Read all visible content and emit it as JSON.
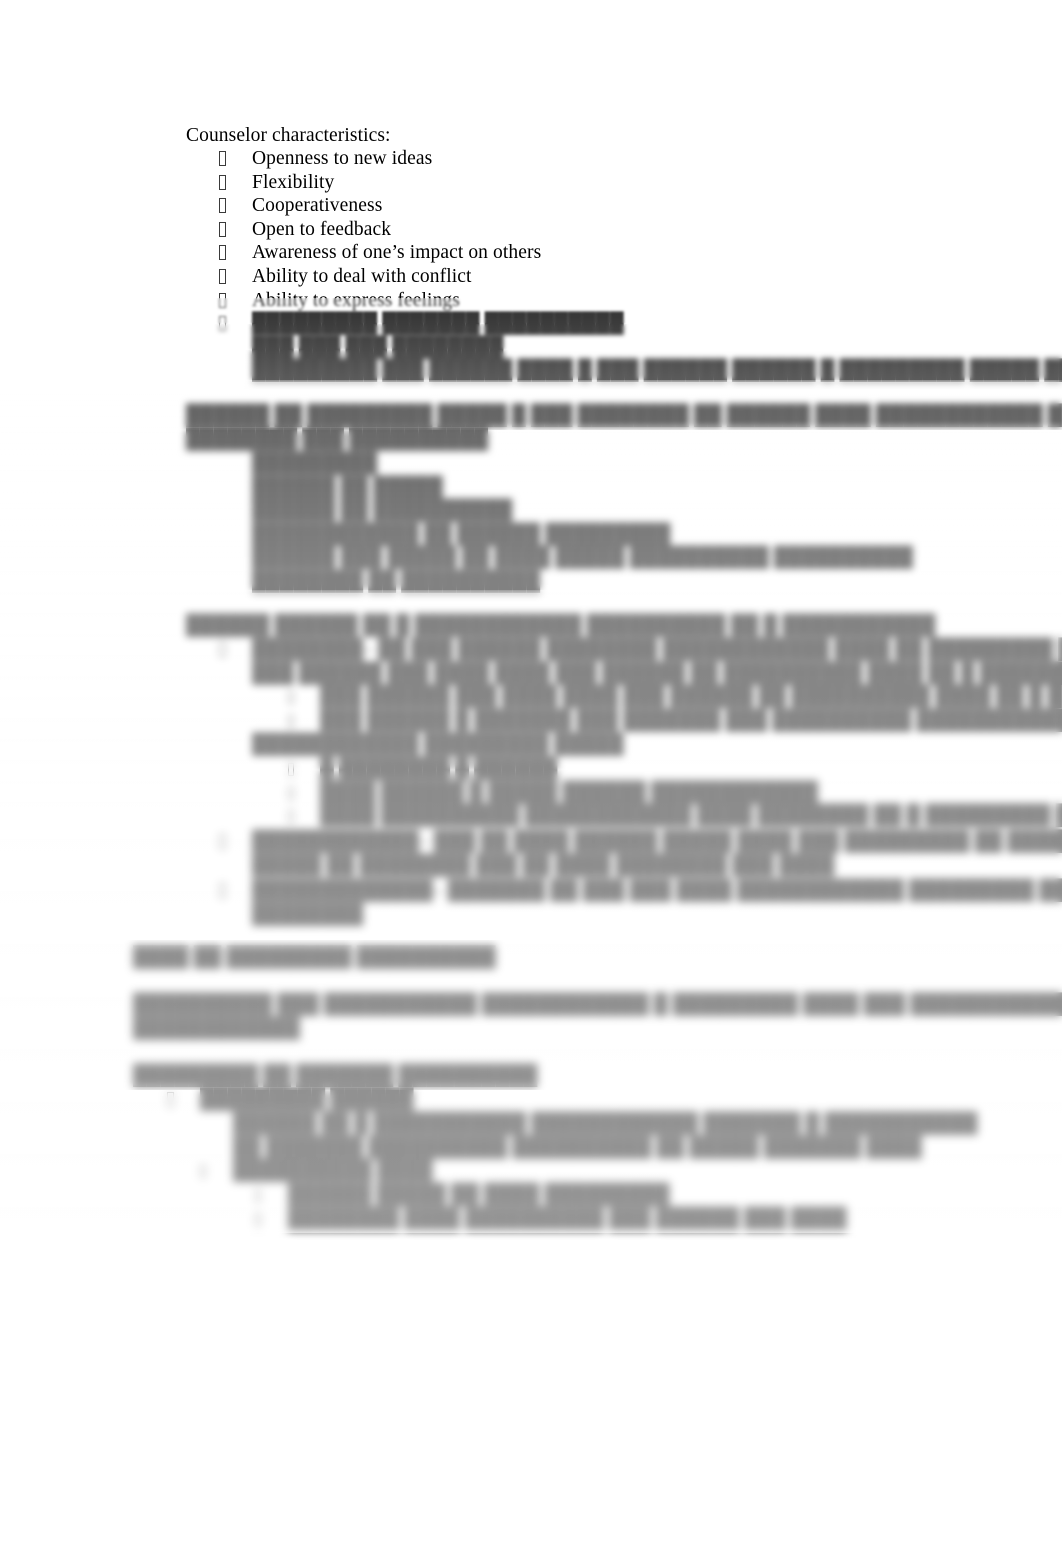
{
  "document": {
    "page_background": "#ffffff",
    "text_color": "#000000",
    "note": "Scanned/редacted study-notes page; only the upper portion is legible, lower portion is progressively blurred."
  },
  "sections": [
    {
      "id": "counselor-characteristics",
      "heading": "Counselor characteristics:",
      "bullet_glyph": "tofu-box",
      "items": [
        "Openness to new ideas",
        "Flexibility",
        "Cooperativeness",
        "Open to feedback",
        "Awareness of one’s impact on others",
        "Ability to deal with conflict",
        "Ability to express feelings"
      ],
      "blurred_items": [
        "█████████ ███████ ██████████",
        "███ ███ ███ ████████",
        "█████████ ███ ██████ ████ █ ███ ██████ ██████ █ █████████ █████ ██████"
      ]
    },
    {
      "id": "blurred-paragraph-1",
      "paragraph_lines": [
        "██████ ██ █████████ █████ █ ███ ████████ ██ ██████ ████ ████████████ ████████████ ████ ██████",
        "████████ ███ ██████████"
      ],
      "bullet_glyph": "tofu-box",
      "blurred_items": [
        "█████████",
        "██████ ██ █████",
        "██████ ██ ██████████",
        "████████████ ██ ██████ █████████",
        "██████ ███ █████ ██ ████ █████ ██████████ ██████████",
        "████████ ██ ██████████"
      ]
    },
    {
      "id": "blurred-paragraph-2",
      "paragraph_lines": [
        "██████ ██████ ██ █ ████████████ ██████████ ██ █ ███████████"
      ],
      "labelled_items": [
        {
          "label": "████████",
          "text": "– ██ ███ ██████ ████████ ████████████ ████ ██ █████████ ██ █████ █████ █████",
          "subitems": [
            "███ ██████ ███ ████ ████ ███ ██████ ██ ██████████ ████ ██ █ █████████",
            "███ ██████ █ ███████ ███ ███████ ███ ██████████ ████████████"
          ]
        },
        {
          "label": "████████████ █████████ █████",
          "text": "",
          "subitems": [
            "█ ████████ █ ██████",
            "████ ██████ █ █████ ██████ ████████████",
            "████ ██████████ ████████████ ████ ████████ ██ █ █████████ █████ ██ ██████████"
          ]
        }
      ]
    },
    {
      "id": "blurred-labelled-list",
      "items": [
        {
          "label": "████████████",
          "line1": "– ███ ██ ████ ██████ █████ ████ ███ █████████ ██ ██████████████ ███",
          "line2": "█████ ██ ████████ ███ ██ ████ ████████ ███ ████"
        },
        {
          "label": "█████████████",
          "line1": "– ███████ ██ ███ ███ ████ ████████████ █████████ ████████ ██ █████████████",
          "line2": "████████"
        }
      ]
    },
    {
      "id": "blurred-heading-1",
      "heading": "████ ██ █████████ ██████████"
    },
    {
      "id": "blurred-paragraph-3",
      "paragraph_lines": [
        "██████████ ███ ███████████ ████████████ █ █████████ ████ ███ ████████████ ███ ████ ██████████",
        "████████████"
      ]
    },
    {
      "id": "blurred-heading-2",
      "heading": "█████████ ██ ███████ ██████████"
    },
    {
      "id": "blurred-final-list",
      "bullet_glyph": "tofu-box",
      "items": [
        {
          "text": "█████████ ██████",
          "sublines": [
            "██████ ██ █ ███████████ ████████████ ███████ █ ███████████",
            "██ ███████ ██████████ ██████████ ██ █████ ███████ ████"
          ]
        },
        {
          "text": "██████████ ████",
          "subbullets": [
            "██████ █████ ██ ████ █████████",
            "████████ ████ ██████████ ███ ██████ ███ ████"
          ]
        }
      ]
    }
  ]
}
